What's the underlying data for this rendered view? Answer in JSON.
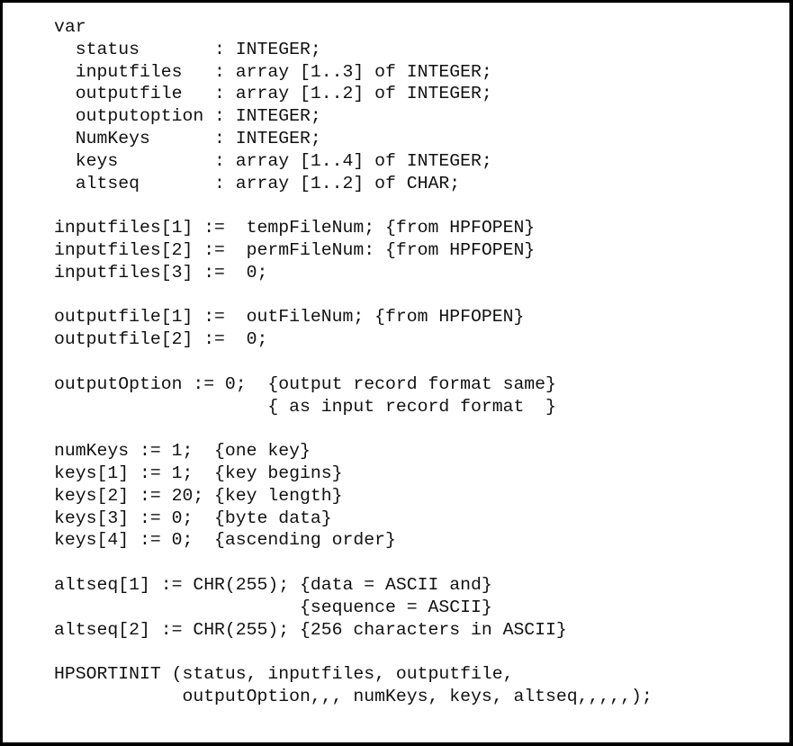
{
  "document": {
    "type": "code-listing",
    "language": "Pascal",
    "lines": [
      "var",
      "  status       : INTEGER;",
      "  inputfiles   : array [1..3] of INTEGER;",
      "  outputfile   : array [1..2] of INTEGER;",
      "  outputoption : INTEGER;",
      "  NumKeys      : INTEGER;",
      "  keys         : array [1..4] of INTEGER;",
      "  altseq       : array [1..2] of CHAR;",
      "",
      "inputfiles[1] :=  tempFileNum; {from HPFOPEN}",
      "inputfiles[2] :=  permFileNum: {from HPFOPEN}",
      "inputfiles[3] :=  0;",
      "",
      "outputfile[1] :=  outFileNum; {from HPFOPEN}",
      "outputfile[2] :=  0;",
      "",
      "outputOption := 0;  {output record format same}",
      "                    { as input record format  }",
      "",
      "numKeys := 1;  {one key}",
      "keys[1] := 1;  {key begins}",
      "keys[2] := 20; {key length}",
      "keys[3] := 0;  {byte data}",
      "keys[4] := 0;  {ascending order}",
      "",
      "altseq[1] := CHR(255); {data = ASCII and}",
      "                       {sequence = ASCII}",
      "altseq[2] := CHR(255); {256 characters in ASCII}",
      "",
      "HPSORTINIT (status, inputfiles, outputfile,",
      "            outputOption,,, numKeys, keys, altseq,,,,,);"
    ]
  }
}
